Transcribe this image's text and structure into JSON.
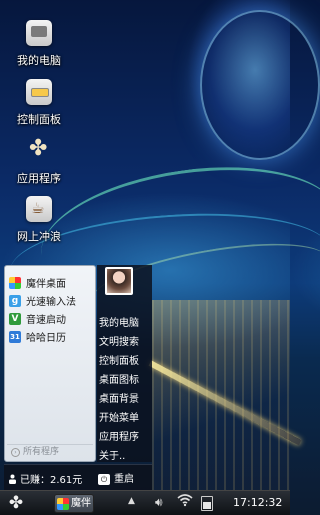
{
  "desktop": {
    "icons": [
      {
        "label": "我的电脑",
        "icon": "computer-icon"
      },
      {
        "label": "控制面板",
        "icon": "control-panel-icon"
      },
      {
        "label": "应用程序",
        "icon": "apps-icon"
      },
      {
        "label": "网上冲浪",
        "icon": "web-icon"
      }
    ]
  },
  "start_menu": {
    "pinned": [
      {
        "label": "魔伴桌面",
        "icon": "mobanzhuomian-icon",
        "color": "#4a8ee0"
      },
      {
        "label": "光速输入法",
        "icon": "input-method-icon",
        "color": "#3aa0e8"
      },
      {
        "label": "音速启动",
        "icon": "quick-launch-icon",
        "color": "#2f9a3c"
      },
      {
        "label": "哈哈日历",
        "icon": "calendar-icon",
        "color": "#2f7bd8"
      }
    ],
    "all_programs_label": "所有程序",
    "links": [
      "我的电脑",
      "文明搜索",
      "控制面板",
      "桌面图标",
      "桌面背景",
      "开始菜单",
      "应用程序",
      "关于.."
    ],
    "earned_label": "已赚：2.61元",
    "restart_label": "重启"
  },
  "taskbar": {
    "start_icon": "clover-icon",
    "running_app_label": "魔伴",
    "clock": "17:12:32"
  }
}
